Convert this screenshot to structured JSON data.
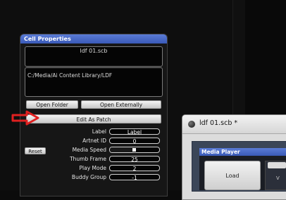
{
  "cell_properties": {
    "title": "Cell Properties",
    "filename": "ldf 01.scb",
    "path": "C:/Media/Ai Content Library/LDF",
    "open_folder_label": "Open Folder",
    "open_externally_label": "Open Externally",
    "edit_as_patch_label": "Edit As Patch",
    "reset_label": "Reset",
    "props": [
      {
        "label": "Label",
        "value": "Label"
      },
      {
        "label": "Artnet ID",
        "value": "0"
      },
      {
        "label": "Media Speed",
        "value": ""
      },
      {
        "label": "Thumb Frame",
        "value": "25"
      },
      {
        "label": "Play Mode",
        "value": "2"
      },
      {
        "label": "Buddy Group",
        "value": "-1"
      }
    ],
    "media_speed_level": 0.5
  },
  "annotation": {
    "arrow_color": "#e02020"
  },
  "patch_window": {
    "title": "ldf 01.scb *",
    "media_player_title": "Media Player",
    "load_label": "Load",
    "side_text": "V"
  },
  "colors": {
    "accent": "#4a6cd0",
    "panel_bg": "#161616"
  }
}
